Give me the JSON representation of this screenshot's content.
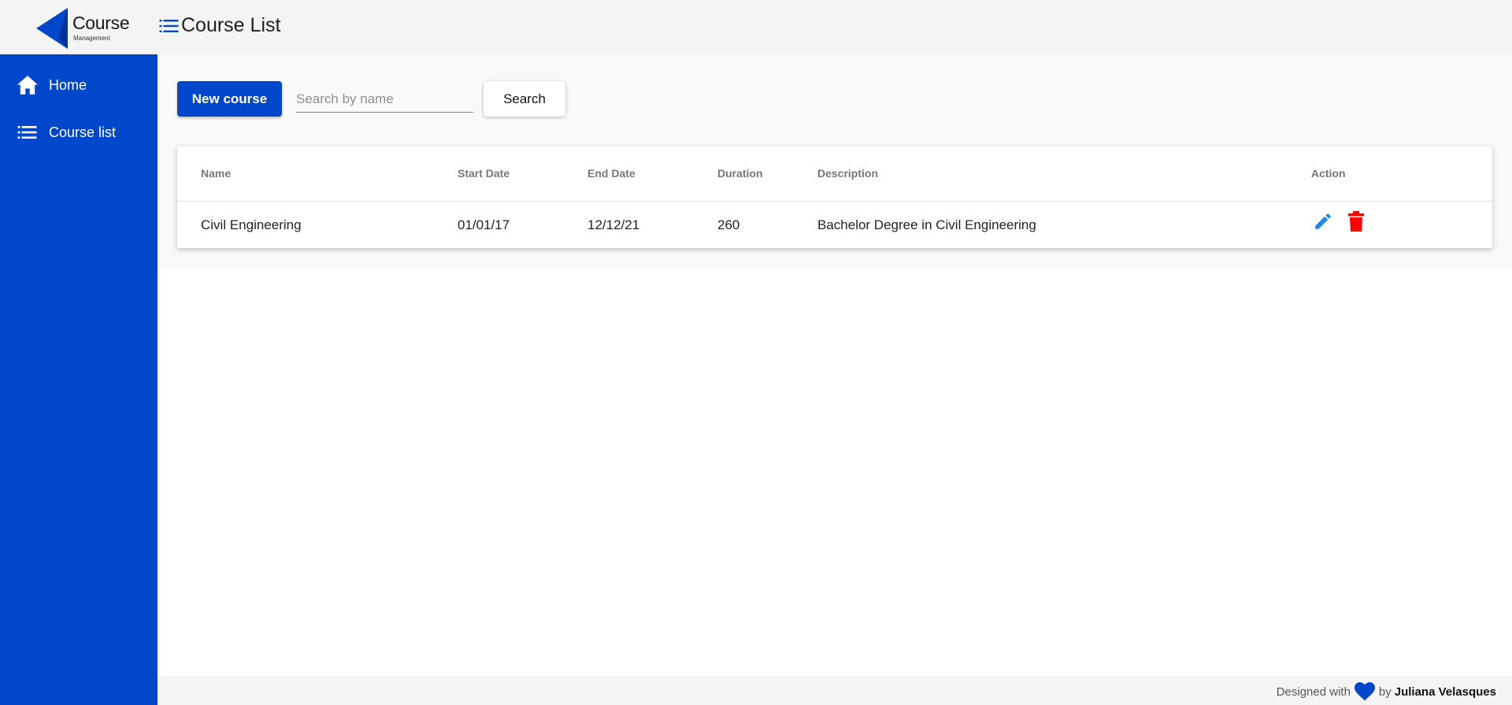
{
  "app": {
    "logo_title": "Course",
    "logo_subtitle": "Management",
    "page_title": "Course List"
  },
  "colors": {
    "primary": "#0047cc",
    "edit_icon": "#1e88e5",
    "delete_icon": "#ff0000"
  },
  "sidebar": {
    "items": [
      {
        "label": "Home",
        "icon": "home-icon"
      },
      {
        "label": "Course list",
        "icon": "list-icon"
      }
    ]
  },
  "toolbar": {
    "new_course_label": "New course",
    "search_placeholder": "Search by name",
    "search_value": "",
    "search_label": "Search"
  },
  "table": {
    "columns": [
      "Name",
      "Start Date",
      "End Date",
      "Duration",
      "Description",
      "Action"
    ],
    "rows": [
      {
        "name": "Civil Engineering",
        "start_date": "01/01/17",
        "end_date": "12/12/21",
        "duration": "260",
        "description": "Bachelor Degree in Civil Engineering",
        "actions": [
          "pencil-icon",
          "trash-icon"
        ]
      }
    ]
  },
  "footer": {
    "prefix": "Designed with",
    "connector": "by",
    "author": "Juliana Velasques"
  }
}
